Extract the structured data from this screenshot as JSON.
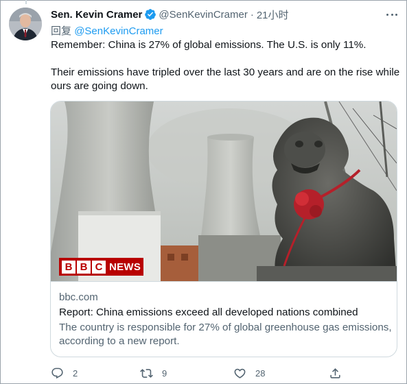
{
  "tweet": {
    "author_name": "Sen. Kevin Cramer",
    "handle": "@SenKevinCramer",
    "separator": "·",
    "time": "21小时",
    "reply_prefix": "回复",
    "reply_to": "@SenKevinCramer",
    "text": [
      "Remember: China is 27% of global emissions. The U.S. is only 11%.",
      "Their emissions have tripled over the last 30 years and are on the rise while ours are going down."
    ]
  },
  "card": {
    "logo_box_letters": [
      "B",
      "B",
      "C"
    ],
    "logo_word": "NEWS",
    "domain": "bbc.com",
    "title": "Report: China emissions exceed all developed nations combined",
    "description": "The country is responsible for 27% of global greenhouse gas emissions, according to a new report."
  },
  "actions": {
    "reply_count": "2",
    "retweet_count": "9",
    "like_count": "28"
  },
  "icons": {
    "verified": "verified-badge-icon",
    "more": "more-icon",
    "reply": "reply-icon",
    "retweet": "retweet-icon",
    "like": "heart-icon",
    "share": "share-icon"
  },
  "colors": {
    "accent": "#1d9bf0",
    "text_primary": "#0f1419",
    "text_secondary": "#536471",
    "border": "#cfd9de",
    "bbc_red": "#b80000"
  }
}
